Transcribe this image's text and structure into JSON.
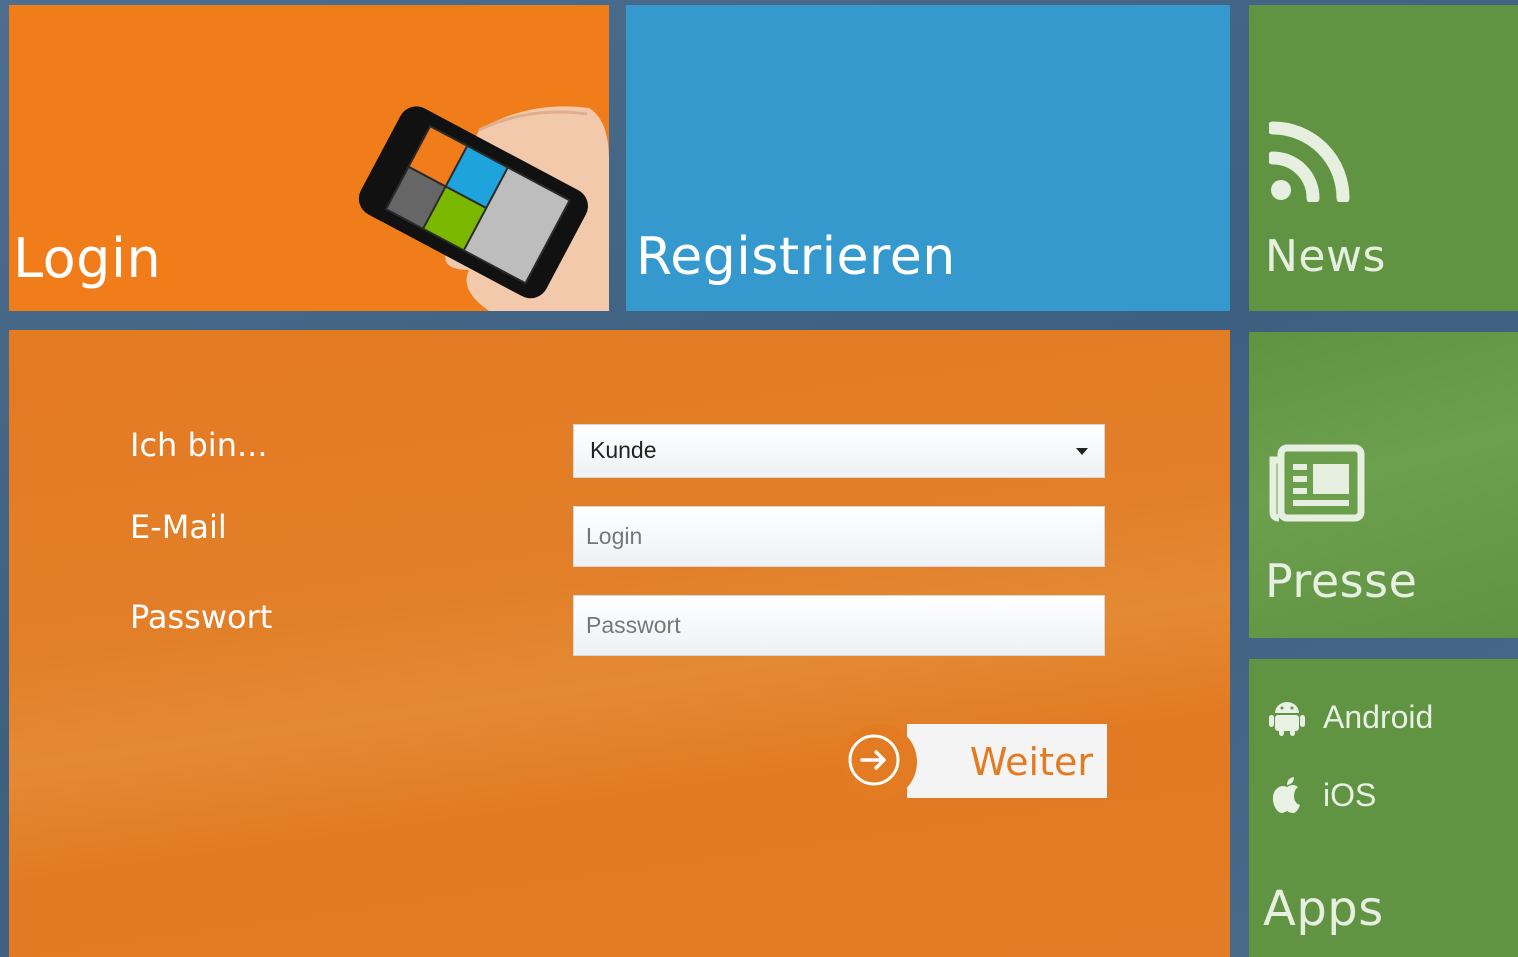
{
  "tiles": {
    "login": {
      "title": "Login"
    },
    "register": {
      "title": "Registrieren"
    },
    "news": {
      "title": "News",
      "icon": "rss-icon"
    },
    "presse": {
      "title": "Presse",
      "icon": "newspaper-icon"
    },
    "apps": {
      "title": "Apps",
      "links": [
        {
          "label": "Android",
          "icon": "android-icon"
        },
        {
          "label": "iOS",
          "icon": "apple-icon"
        }
      ]
    }
  },
  "form": {
    "role_label": "Ich bin...",
    "role_value": "Kunde",
    "email_label": "E-Mail",
    "email_placeholder": "Login",
    "password_label": "Passwort",
    "password_placeholder": "Passwort",
    "submit_label": "Weiter"
  },
  "colors": {
    "login_tile": "#f07d19",
    "register_tile": "#3599ce",
    "side_tiles": "#609442",
    "form_panel": "#e37c26",
    "background": "#4c6f8f"
  }
}
